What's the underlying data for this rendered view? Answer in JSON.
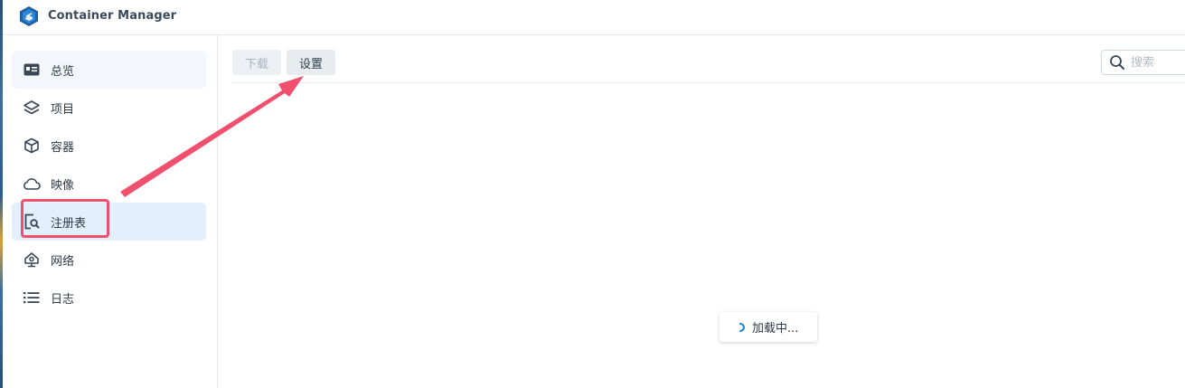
{
  "app": {
    "title": "Container Manager",
    "logo_icon": "container-manager-logo"
  },
  "sidebar": {
    "items": [
      {
        "label": "总览",
        "icon": "overview-icon"
      },
      {
        "label": "项目",
        "icon": "layers-icon"
      },
      {
        "label": "容器",
        "icon": "cube-icon"
      },
      {
        "label": "映像",
        "icon": "cloud-icon"
      },
      {
        "label": "注册表",
        "icon": "registry-search-icon",
        "active": true
      },
      {
        "label": "网络",
        "icon": "network-icon"
      },
      {
        "label": "日志",
        "icon": "list-icon"
      }
    ]
  },
  "toolbar": {
    "download_label": "下载",
    "download_disabled": true,
    "settings_label": "设置"
  },
  "search": {
    "placeholder": "搜索",
    "value": ""
  },
  "loading": {
    "text": "加载中..."
  },
  "colors": {
    "accent": "#1e7ad8",
    "active_bg": "#e3effc",
    "annotation": "#f0506e"
  }
}
